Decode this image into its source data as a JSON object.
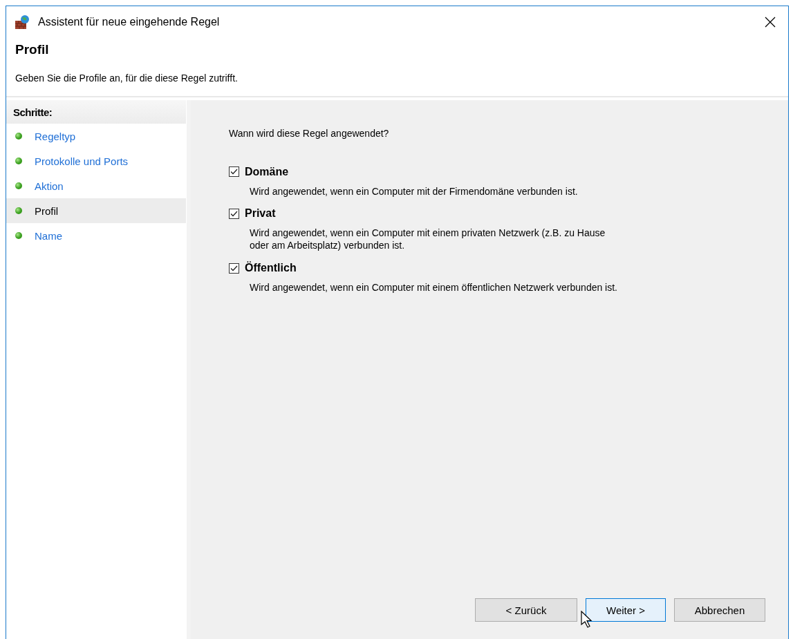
{
  "window": {
    "title": "Assistent für neue eingehende Regel"
  },
  "header": {
    "title": "Profil",
    "subtitle": "Geben Sie die Profile an, für die diese Regel zutrifft."
  },
  "steps": {
    "heading": "Schritte:",
    "items": [
      {
        "label": "Regeltyp",
        "selected": false
      },
      {
        "label": "Protokolle und Ports",
        "selected": false
      },
      {
        "label": "Aktion",
        "selected": false
      },
      {
        "label": "Profil",
        "selected": true
      },
      {
        "label": "Name",
        "selected": false
      }
    ]
  },
  "question": "Wann wird diese Regel angewendet?",
  "profiles": [
    {
      "label": "Domäne",
      "checked": true,
      "description": "Wird angewendet, wenn ein Computer mit der Firmendomäne verbunden ist."
    },
    {
      "label": "Privat",
      "checked": true,
      "description": "Wird angewendet, wenn ein Computer mit einem privaten Netzwerk (z.B. zu Hause\noder am Arbeitsplatz) verbunden ist."
    },
    {
      "label": "Öffentlich",
      "checked": true,
      "description": "Wird angewendet, wenn ein Computer mit einem öffentlichen Netzwerk verbunden ist."
    }
  ],
  "buttons": [
    {
      "label": "< Zurück",
      "default": false
    },
    {
      "label": "Weiter >",
      "default": true
    },
    {
      "label": "Abbrechen",
      "default": false
    }
  ]
}
